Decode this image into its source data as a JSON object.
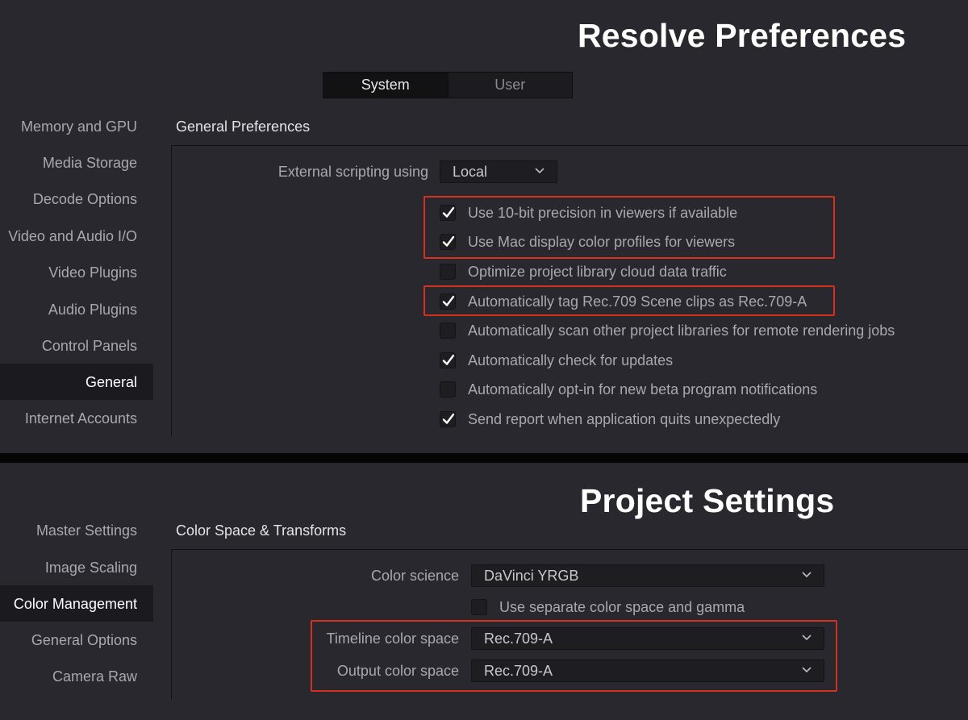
{
  "top": {
    "title": "Resolve Preferences",
    "tabs": [
      {
        "label": "System",
        "active": true
      },
      {
        "label": "User",
        "active": false
      }
    ],
    "sidebar": [
      {
        "label": "Memory and GPU"
      },
      {
        "label": "Media Storage"
      },
      {
        "label": "Decode Options"
      },
      {
        "label": "Video and Audio I/O"
      },
      {
        "label": "Video Plugins"
      },
      {
        "label": "Audio Plugins"
      },
      {
        "label": "Control Panels"
      },
      {
        "label": "General",
        "selected": true
      },
      {
        "label": "Internet Accounts"
      }
    ],
    "section_title": "General Preferences",
    "scripting": {
      "label": "External scripting using",
      "value": "Local"
    },
    "checkboxes": [
      {
        "label": "Use 10-bit precision in viewers if available",
        "checked": true,
        "icon": "checkmark-icon"
      },
      {
        "label": "Use Mac display color profiles for viewers",
        "checked": true,
        "icon": "checkmark-icon"
      },
      {
        "label": "Optimize project library cloud data traffic",
        "checked": false
      },
      {
        "label": "Automatically tag Rec.709 Scene clips as Rec.709-A",
        "checked": true,
        "icon": "checkmark-icon"
      },
      {
        "label": "Automatically scan other project libraries for remote rendering jobs",
        "checked": false
      },
      {
        "label": "Automatically check for updates",
        "checked": true,
        "icon": "checkmark-icon"
      },
      {
        "label": "Automatically opt-in for new beta program notifications",
        "checked": false
      },
      {
        "label": "Send report when application quits unexpectedly",
        "checked": true,
        "icon": "checkmark-icon"
      }
    ]
  },
  "bottom": {
    "title": "Project Settings",
    "sidebar": [
      {
        "label": "Master Settings"
      },
      {
        "label": "Image Scaling"
      },
      {
        "label": "Color Management",
        "selected": true
      },
      {
        "label": "General Options"
      },
      {
        "label": "Camera Raw"
      }
    ],
    "section_title": "Color Space & Transforms",
    "color_science": {
      "label": "Color science",
      "value": "DaVinci YRGB"
    },
    "separate_checkbox": {
      "label": "Use separate color space and gamma",
      "checked": false
    },
    "timeline_space": {
      "label": "Timeline color space",
      "value": "Rec.709-A"
    },
    "output_space": {
      "label": "Output color space",
      "value": "Rec.709-A"
    }
  },
  "colors": {
    "background": "#28282e",
    "highlight_box": "#d6301e",
    "title_text": "#ffffff"
  }
}
